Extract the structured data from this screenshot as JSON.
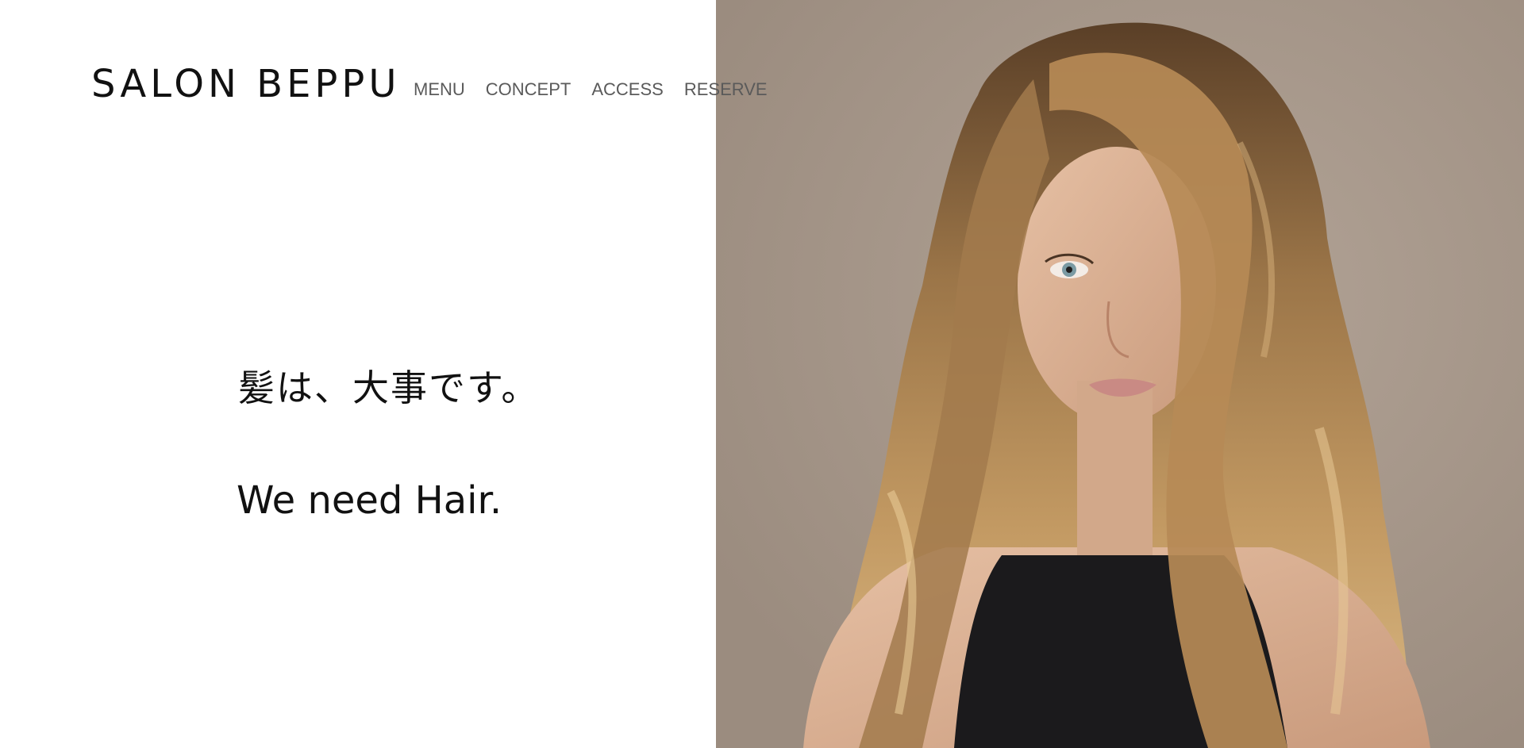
{
  "header": {
    "logo": "SALON BEPPU",
    "nav": [
      {
        "label": "MENU"
      },
      {
        "label": "CONCEPT"
      },
      {
        "label": "ACCESS"
      },
      {
        "label": "RESERVE"
      }
    ]
  },
  "hero": {
    "headline_jp": "髪は、大事です。",
    "headline_en": "We need Hair."
  },
  "colors": {
    "background": "#ffffff",
    "text": "#111111",
    "nav_text": "#5a5a5a",
    "photo_backdrop": "#a69689"
  }
}
